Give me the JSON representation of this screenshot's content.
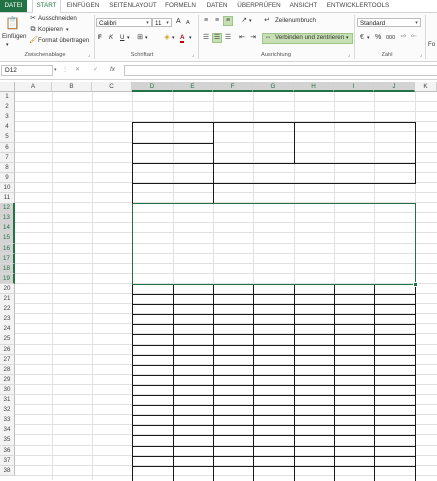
{
  "tabs": [
    "DATEI",
    "START",
    "EINFÜGEN",
    "SEITENLAYOUT",
    "FORMELN",
    "DATEN",
    "ÜBERPRÜFEN",
    "ANSICHT",
    "ENTWICKLERTOOLS"
  ],
  "clipboard": {
    "paste_label": "Einfügen",
    "cut_label": "Ausschneiden",
    "copy_label": "Kopieren",
    "format_painter_label": "Format übertragen",
    "group_label": "Zwischenablage"
  },
  "font": {
    "font_name": "Calibri",
    "font_size": "11",
    "grow_label": "A",
    "shrink_label": "A",
    "bold_label": "F",
    "italic_label": "K",
    "underline_label": "U",
    "font_color_label": "A",
    "group_label": "Schriftart"
  },
  "alignment": {
    "wrap_text_label": "Zeilenumbruch",
    "merge_center_label": "Verbinden und zentrieren",
    "group_label": "Ausrichtung"
  },
  "number": {
    "format_value": "Standard",
    "percent_label": "%",
    "thousands_label": "000",
    "group_label": "Zahl"
  },
  "overflow_label": "Fo",
  "formula_bar": {
    "name_box_value": "D12",
    "fx_label": "fx",
    "cancel_label": "✕",
    "enter_label": "✓",
    "formula_value": ""
  },
  "columns": [
    "A",
    "B",
    "C",
    "D",
    "E",
    "F",
    "G",
    "H",
    "I",
    "J",
    "K"
  ],
  "selected_columns": [
    "D",
    "E",
    "F",
    "G",
    "H",
    "I",
    "J"
  ],
  "rows": [
    "1",
    "2",
    "3",
    "4",
    "5",
    "6",
    "7",
    "8",
    "9",
    "10",
    "11",
    "12",
    "13",
    "14",
    "15",
    "16",
    "17",
    "18",
    "19",
    "20",
    "21",
    "22",
    "23",
    "24",
    "25",
    "26",
    "27",
    "28",
    "29",
    "30",
    "31",
    "32",
    "33",
    "34",
    "35",
    "36",
    "37",
    "38"
  ],
  "selected_rows": [
    "12",
    "13",
    "14",
    "15",
    "16",
    "17",
    "18",
    "19"
  ],
  "active_cell": "D12",
  "colors": {
    "accent": "#217346",
    "highlight": "#c6e0b4",
    "border": "#1a1a1a"
  }
}
